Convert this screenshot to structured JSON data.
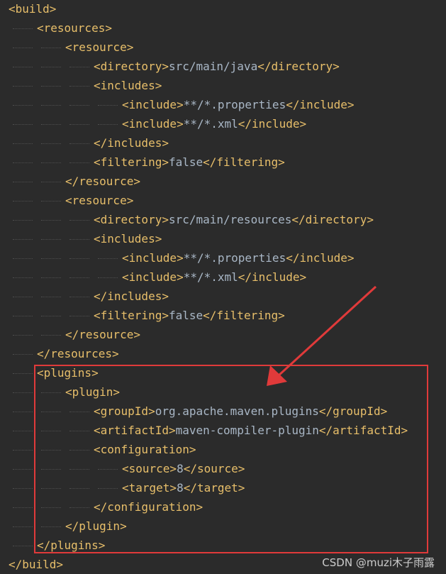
{
  "editor": {
    "lines": [
      {
        "indent": 0,
        "open": "<build>",
        "text": "",
        "close": ""
      },
      {
        "indent": 1,
        "open": "<resources>",
        "text": "",
        "close": ""
      },
      {
        "indent": 2,
        "open": "<resource>",
        "text": "",
        "close": ""
      },
      {
        "indent": 3,
        "open": "<directory>",
        "text": "src/main/java",
        "close": "</directory>"
      },
      {
        "indent": 3,
        "open": "<includes>",
        "text": "",
        "close": ""
      },
      {
        "indent": 4,
        "open": "<include>",
        "text": "**/*.properties",
        "close": "</include>"
      },
      {
        "indent": 4,
        "open": "<include>",
        "text": "**/*.xml",
        "close": "</include>"
      },
      {
        "indent": 3,
        "open": "</includes>",
        "text": "",
        "close": ""
      },
      {
        "indent": 3,
        "open": "<filtering>",
        "text": "false",
        "close": "</filtering>"
      },
      {
        "indent": 2,
        "open": "</resource>",
        "text": "",
        "close": ""
      },
      {
        "indent": 2,
        "open": "<resource>",
        "text": "",
        "close": ""
      },
      {
        "indent": 3,
        "open": "<directory>",
        "text": "src/main/resources",
        "close": "</directory>"
      },
      {
        "indent": 3,
        "open": "<includes>",
        "text": "",
        "close": ""
      },
      {
        "indent": 4,
        "open": "<include>",
        "text": "**/*.properties",
        "close": "</include>"
      },
      {
        "indent": 4,
        "open": "<include>",
        "text": "**/*.xml",
        "close": "</include>"
      },
      {
        "indent": 3,
        "open": "</includes>",
        "text": "",
        "close": ""
      },
      {
        "indent": 3,
        "open": "<filtering>",
        "text": "false",
        "close": "</filtering>"
      },
      {
        "indent": 2,
        "open": "</resource>",
        "text": "",
        "close": ""
      },
      {
        "indent": 1,
        "open": "</resources>",
        "text": "",
        "close": ""
      },
      {
        "indent": 1,
        "open": "<plugins>",
        "text": "",
        "close": ""
      },
      {
        "indent": 2,
        "open": "<plugin>",
        "text": "",
        "close": ""
      },
      {
        "indent": 3,
        "open": "<groupId>",
        "text": "org.apache.maven.plugins",
        "close": "</groupId>"
      },
      {
        "indent": 3,
        "open": "<artifactId>",
        "text": "maven-compiler-plugin",
        "close": "</artifactId>"
      },
      {
        "indent": 3,
        "open": "<configuration>",
        "text": "",
        "close": ""
      },
      {
        "indent": 4,
        "open": "<source>",
        "text": "8",
        "close": "</source>"
      },
      {
        "indent": 4,
        "open": "<target>",
        "text": "8",
        "close": "</target>"
      },
      {
        "indent": 3,
        "open": "</configuration>",
        "text": "",
        "close": ""
      },
      {
        "indent": 2,
        "open": "</plugin>",
        "text": "",
        "close": ""
      },
      {
        "indent": 1,
        "open": "</plugins>",
        "text": "",
        "close": ""
      },
      {
        "indent": 0,
        "open": "</build>",
        "text": "",
        "close": ""
      }
    ]
  },
  "annotation": {
    "box_color": "#e03a3a",
    "arrow_color": "#e03a3a"
  },
  "watermark": {
    "text": "CSDN @muzi木子雨露"
  },
  "colors": {
    "background": "#2b2b2b",
    "tag": "#e8bf6a",
    "text": "#a9b7c6"
  }
}
